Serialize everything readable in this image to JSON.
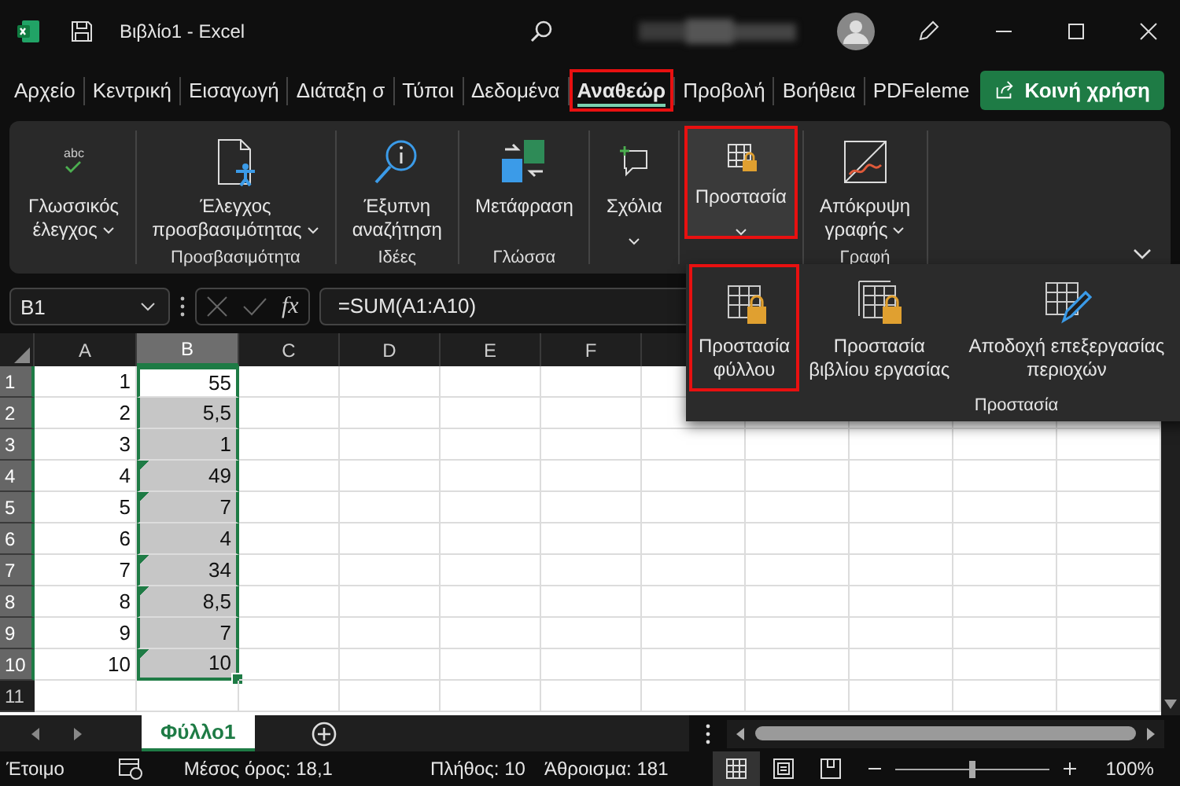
{
  "title_bar": {
    "title": "Βιβλίο1 - Excel"
  },
  "tabs": [
    {
      "label": "Αρχείο",
      "selected": false,
      "highlighted": false
    },
    {
      "label": "Κεντρική",
      "selected": false,
      "highlighted": false
    },
    {
      "label": "Εισαγωγή",
      "selected": false,
      "highlighted": false
    },
    {
      "label": "Διάταξη σ",
      "selected": false,
      "highlighted": false
    },
    {
      "label": "Τύποι",
      "selected": false,
      "highlighted": false
    },
    {
      "label": "Δεδομένα",
      "selected": false,
      "highlighted": false
    },
    {
      "label": "Αναθεώρ",
      "selected": true,
      "highlighted": true
    },
    {
      "label": "Προβολή",
      "selected": false,
      "highlighted": false
    },
    {
      "label": "Βοήθεια",
      "selected": false,
      "highlighted": false
    },
    {
      "label": "PDFeleme",
      "selected": false,
      "highlighted": false
    }
  ],
  "share_button": {
    "label": "Κοινή χρήση"
  },
  "ribbon": {
    "groups": [
      {
        "buttons": [
          {
            "lines": [
              "Γλωσσικός",
              "έλεγχος"
            ],
            "icon_text": "abc",
            "dropdown": true,
            "highlighted": false,
            "pressed": false
          }
        ]
      },
      {
        "label": "Προσβασιμότητα",
        "buttons": [
          {
            "lines": [
              "Έλεγχος",
              "προσβασιμότητας"
            ],
            "dropdown": true,
            "highlighted": false,
            "pressed": false
          }
        ]
      },
      {
        "label": "Ιδέες",
        "buttons": [
          {
            "lines": [
              "Έξυπνη",
              "αναζήτηση"
            ],
            "dropdown": false,
            "highlighted": false,
            "pressed": false
          }
        ]
      },
      {
        "label": "Γλώσσα",
        "buttons": [
          {
            "lines": [
              "Μετάφραση"
            ],
            "dropdown": false,
            "highlighted": false,
            "pressed": false
          }
        ]
      },
      {
        "buttons": [
          {
            "lines": [
              "Σχόλια"
            ],
            "dropdown": true,
            "highlighted": false,
            "pressed": false
          }
        ]
      },
      {
        "buttons": [
          {
            "lines": [
              "Προστασία"
            ],
            "dropdown": true,
            "highlighted": true,
            "pressed": true
          }
        ]
      },
      {
        "label": "Γραφή",
        "buttons": [
          {
            "lines": [
              "Απόκρυψη",
              "γραφής"
            ],
            "dropdown": true,
            "highlighted": false,
            "pressed": false
          }
        ]
      }
    ]
  },
  "protection_menu": {
    "label": "Προστασία",
    "items": [
      {
        "lines": [
          "Προστασία",
          "φύλλου"
        ],
        "highlighted": true
      },
      {
        "lines": [
          "Προστασία",
          "βιβλίου εργασίας"
        ],
        "highlighted": false
      },
      {
        "lines": [
          "Αποδοχή επεξεργασίας",
          "περιοχών"
        ],
        "highlighted": false
      }
    ]
  },
  "formula_bar": {
    "name_box": "B1",
    "function_label": "fx",
    "formula": "=SUM(A1:A10)"
  },
  "sheet": {
    "columns": [
      {
        "label": "A",
        "selected": false
      },
      {
        "label": "B",
        "selected": true
      },
      {
        "label": "C",
        "selected": false
      },
      {
        "label": "D",
        "selected": false
      },
      {
        "label": "E",
        "selected": false
      },
      {
        "label": "F",
        "selected": false
      }
    ],
    "rows": [
      {
        "header": "1",
        "a": "1",
        "b": "55",
        "selected": true,
        "active": true,
        "flag": false
      },
      {
        "header": "2",
        "a": "2",
        "b": "5,5",
        "selected": true,
        "active": false,
        "flag": false
      },
      {
        "header": "3",
        "a": "3",
        "b": "1",
        "selected": true,
        "active": false,
        "flag": false
      },
      {
        "header": "4",
        "a": "4",
        "b": "49",
        "selected": true,
        "active": false,
        "flag": true
      },
      {
        "header": "5",
        "a": "5",
        "b": "7",
        "selected": true,
        "active": false,
        "flag": true
      },
      {
        "header": "6",
        "a": "6",
        "b": "4",
        "selected": true,
        "active": false,
        "flag": false
      },
      {
        "header": "7",
        "a": "7",
        "b": "34",
        "selected": true,
        "active": false,
        "flag": true
      },
      {
        "header": "8",
        "a": "8",
        "b": "8,5",
        "selected": true,
        "active": false,
        "flag": true
      },
      {
        "header": "9",
        "a": "9",
        "b": "7",
        "selected": true,
        "active": false,
        "flag": false
      },
      {
        "header": "10",
        "a": "10",
        "b": "10",
        "selected": true,
        "active": false,
        "flag": true
      },
      {
        "header": "11",
        "selected": false,
        "active": false,
        "flag": false
      }
    ]
  },
  "sheet_tabs": [
    {
      "label": "Φύλλο1",
      "selected": true
    }
  ],
  "status_bar": {
    "status": "Έτοιμο",
    "average": "Μέσος όρος: 18,1",
    "count": "Πλήθος: 10",
    "sum": "Άθροισμα: 181",
    "views": [
      {
        "selected": true
      },
      {
        "selected": false
      },
      {
        "selected": false
      }
    ],
    "zoom": {
      "level": 0.5,
      "reading": "100%"
    }
  }
}
